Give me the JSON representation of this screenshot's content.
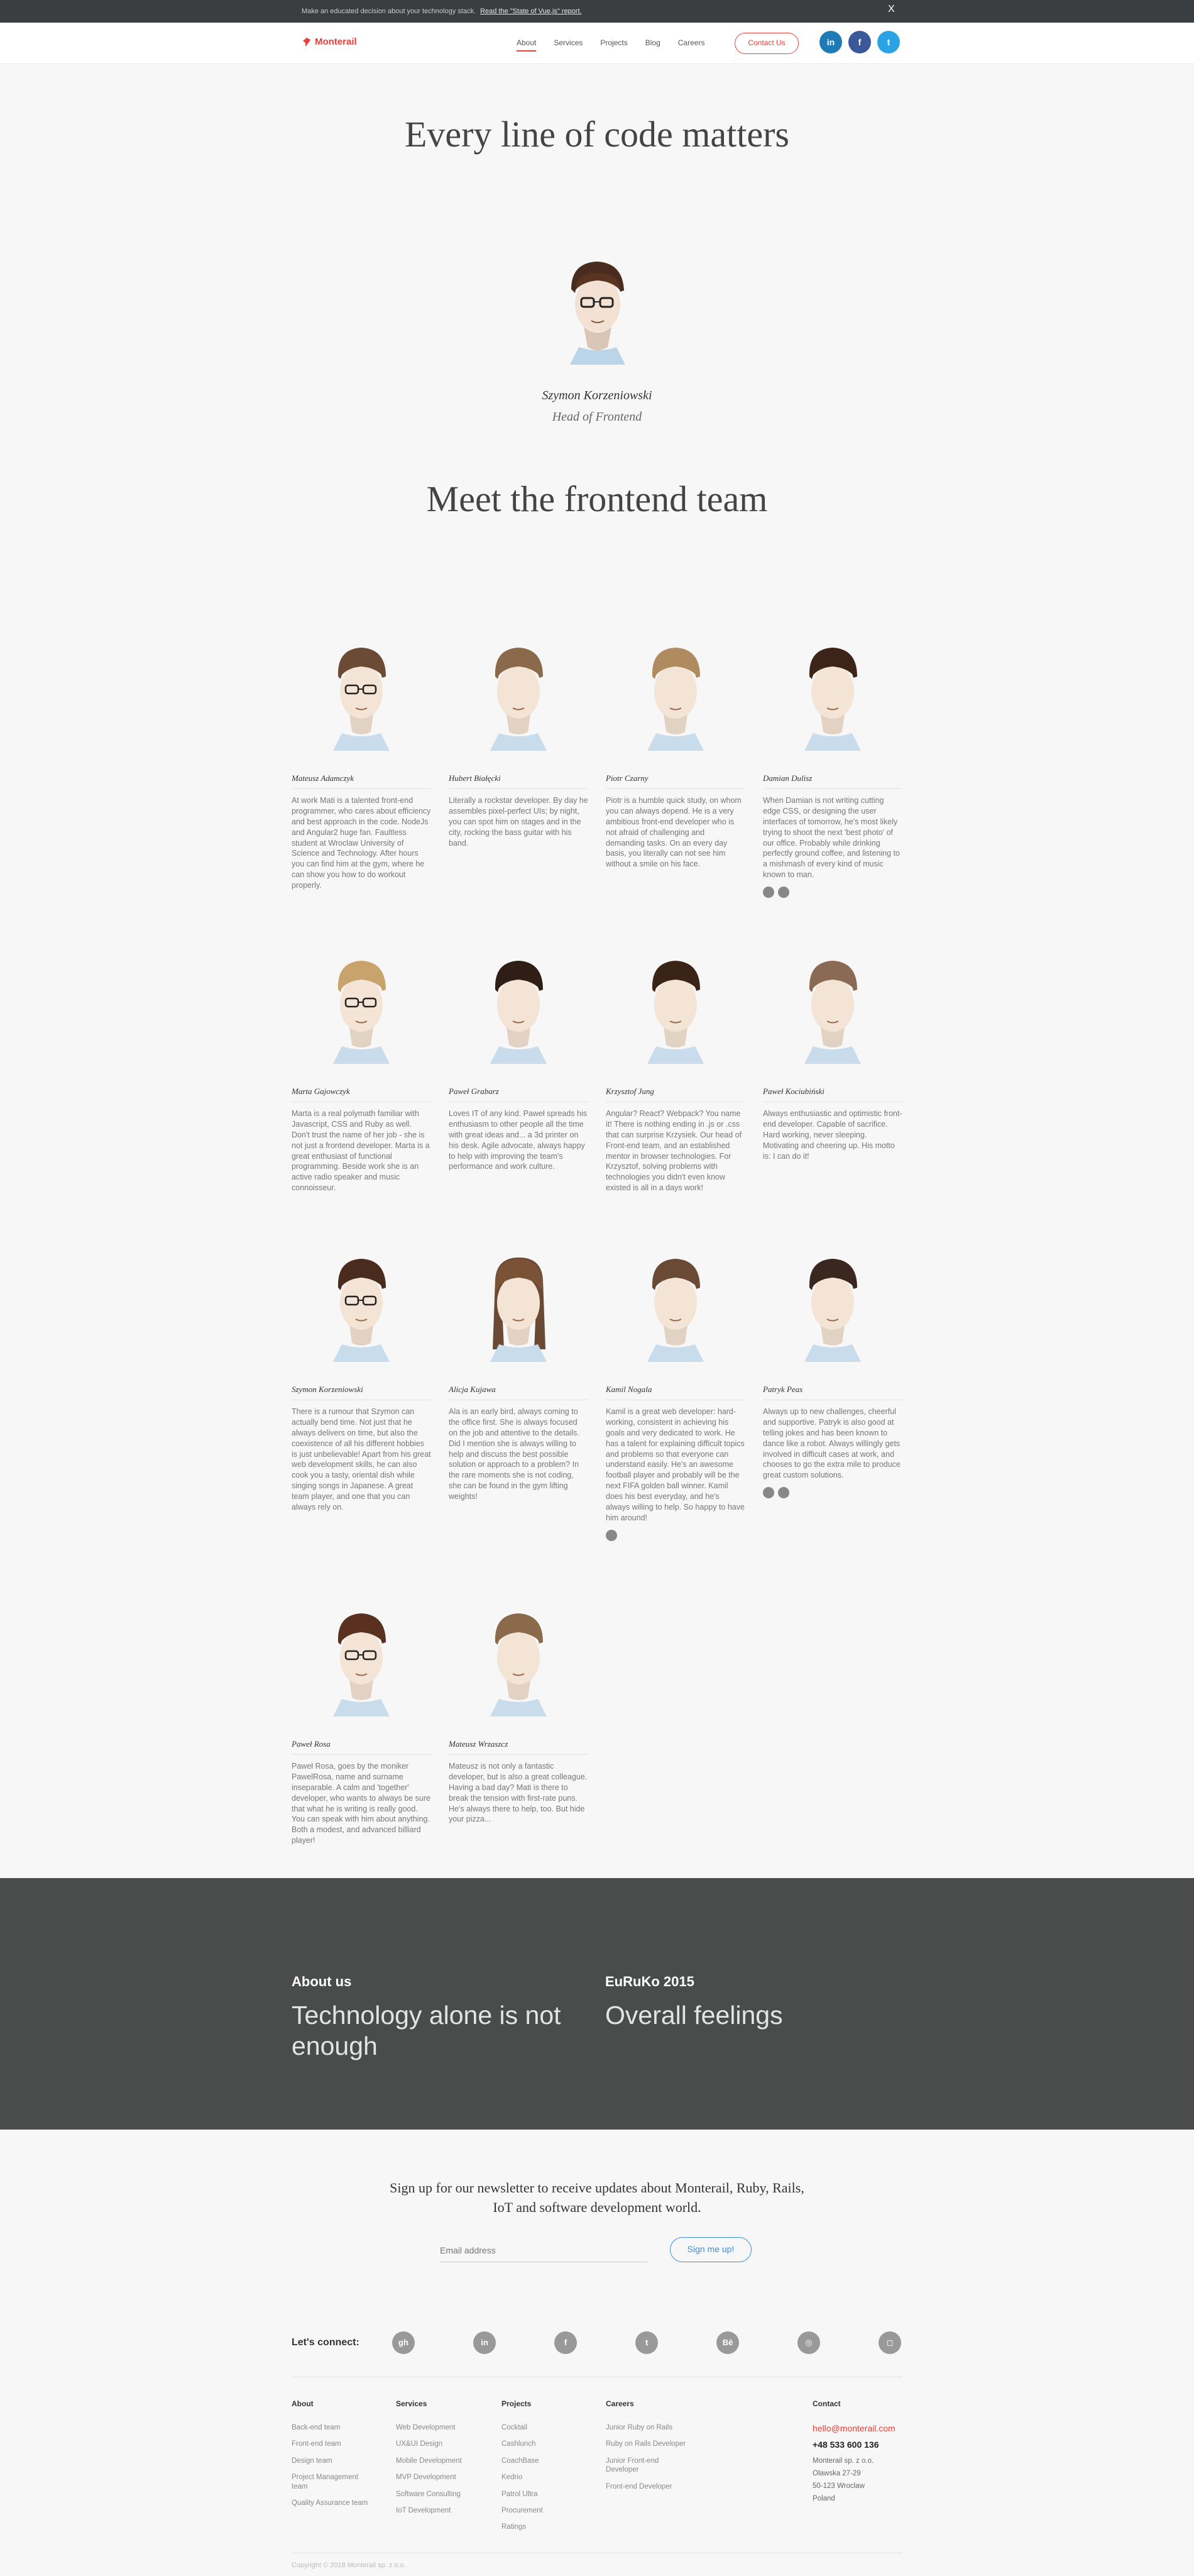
{
  "banner": {
    "text": "Make an educated decision about your technology stack.",
    "link": "Read the \"State of Vue.js\" report.",
    "close": "X"
  },
  "header": {
    "logo": "Monterail",
    "nav": [
      "About",
      "Services",
      "Projects",
      "Blog",
      "Careers"
    ],
    "contact": "Contact Us",
    "social": [
      "in",
      "f",
      "t"
    ]
  },
  "hero": {
    "title": "Every line of code matters",
    "lead_name": "Szymon Korzeniowski",
    "lead_role": "Head of Frontend"
  },
  "team_title": "Meet the frontend team",
  "team": [
    {
      "name": "Mateusz Adamczyk",
      "bio": "At work Mati is a talented front-end programmer, who cares about efficiency and best approach in the code. NodeJs and Angular2 huge fan. Faultless student at Wroclaw University of Science and Technology. After hours you can find him at the gym, where he can show you how to do workout properly.",
      "icons": []
    },
    {
      "name": "Hubert Białęcki",
      "bio": "Literally a rockstar developer. By day he assembles pixel-perfect UIs; by night, you can spot him on stages and in the city, rocking the bass guitar with his band.",
      "icons": []
    },
    {
      "name": "Piotr Czarny",
      "bio": "Piotr is a humble quick study, on whom you can always depend. He is a very ambitious front-end developer who is not afraid of challenging and demanding tasks. On an every day basis, you literally can not see him without a smile on his face.",
      "icons": []
    },
    {
      "name": "Damian Dulisz",
      "bio": "When Damian is not writing cutting edge CSS, or designing the user interfaces of tomorrow, he's most likely trying to shoot the next 'best photo' of our office. Probably while drinking perfectly ground coffee, and listening to a mishmash of every kind of music known to man.",
      "icons": [
        "github",
        "twitter"
      ]
    },
    {
      "name": "Marta Gajowczyk",
      "bio": "Marta is a real polymath familiar with Javascript, CSS and Ruby as well. Don't trust the name of her job - she is not just a frontend developer. Marta is a great enthusiast of functional programming. Beside work she is an active radio speaker and music connoisseur.",
      "icons": []
    },
    {
      "name": "Paweł Grabarz",
      "bio": "Loves IT of any kind. Paweł spreads his enthusiasm to other people all the time with great ideas and... a 3d printer on his desk. Agile advocate, always happy to help with improving the team's performance and work culture.",
      "icons": []
    },
    {
      "name": "Krzysztof Jung",
      "bio": "Angular? React? Webpack? You name it! There is nothing ending in .js or .css that can surprise Krzysiek. Our head of Front-end team, and an established mentor in browser technologies. For Krzysztof, solving problems with technologies you didn't even know existed is all in a days work!",
      "icons": []
    },
    {
      "name": "Paweł Kociubiński",
      "bio": "Always enthusiastic and optimistic front-end developer. Capable of sacrifice. Hard working, never sleeping. Motivating and cheering up. His motto is: I can do it!",
      "icons": []
    },
    {
      "name": "Szymon Korzeniowski",
      "bio": "There is a rumour that Szymon can actually bend time. Not just that he always delivers on time, but also the coexistence of all his different hobbies is just unbelievable! Apart from his great web development skills, he can also cook you a tasty, oriental dish while singing songs in Japanese. A great team player, and one that you can always rely on.",
      "icons": []
    },
    {
      "name": "Alicja Kujawa",
      "bio": "Ala is an early bird, always coming to the office first. She is always focused on the job and attentive to the details. Did I mention she is always willing to help and discuss the best possible solution or approach to a problem? In the rare moments she is not coding, she can be found in the gym lifting weights!",
      "icons": []
    },
    {
      "name": "Kamil Nogala",
      "bio": "Kamil is a great web developer: hard-working, consistent in achieving his goals and very dedicated to work. He has a talent for explaining difficult topics and problems so that everyone can understand easily. He's an awesome football player and probably will be the next FIFA golden ball winner. Kamil does his best everyday, and he's always willing to help. So happy to have him around!",
      "icons": [
        "github"
      ]
    },
    {
      "name": "Patryk Peas",
      "bio": "Always up to new challenges, cheerful and supportive. Patryk is also good at telling jokes and has been known to dance like a robot. Always willingly gets involved in difficult cases at work, and chooses to go the extra mile to produce great custom solutions.",
      "icons": [
        "github",
        "linkedin"
      ]
    },
    {
      "name": "Paweł Rosa",
      "bio": "Paweł Rosa, goes by the moniker PawelRosa, name and surname inseparable. A calm and 'together' developer, who wants to always be sure that what he is writing is really good. You can speak with him about anything. Both a modest, and advanced billiard player!",
      "icons": []
    },
    {
      "name": "Mateusz Wrzaszcz",
      "bio": "Mateusz is not only a fantastic developer, but is also a great colleague. Having a bad day? Mati is there to break the tension with first-rate puns. He's always there to help, too. But hide your pizza...",
      "icons": []
    }
  ],
  "dark": {
    "left_label": "About us",
    "left_text": "Technology alone is not enough",
    "right_label": "EuRuKo 2015",
    "right_text": "Overall feelings"
  },
  "newsletter": {
    "title": "Sign up for our newsletter to receive updates about Monterail, Ruby, Rails, IoT and software development world.",
    "placeholder": "Email address",
    "button": "Sign me up!"
  },
  "connect": {
    "label": "Let's connect:",
    "icons": [
      "github",
      "linkedin",
      "facebook",
      "twitter",
      "behance",
      "dribbble",
      "instagram"
    ]
  },
  "footer": {
    "about": {
      "title": "About",
      "items": [
        "Back-end team",
        "Front-end team",
        "Design team",
        "Project Management team",
        "Quality Assurance team"
      ]
    },
    "services": {
      "title": "Services",
      "items": [
        "Web Development",
        "UX&UI Design",
        "Mobile Development",
        "MVP Development",
        "Software Consulting",
        "IoT Development"
      ]
    },
    "projects": {
      "title": "Projects",
      "items": [
        "Cocktail",
        "Cashlunch",
        "CoachBase",
        "Kedrio",
        "Patrol Ultra",
        "Procurement",
        "Ratings"
      ]
    },
    "careers": {
      "title": "Careers",
      "items": [
        "Junior Ruby on Rails",
        "Ruby on Rails Developer",
        "Junior Front-end Developer",
        "Front-end Developer"
      ]
    },
    "contact": {
      "title": "Contact",
      "email": "hello@monterail.com",
      "phone": "+48 533 600 136",
      "address": [
        "Monterail sp. z o.o.",
        "Olawska 27-29",
        "50-123 Wroclaw",
        "Poland"
      ]
    }
  },
  "copyright": "Copyright © 2018 Monterail sp. z o.o."
}
